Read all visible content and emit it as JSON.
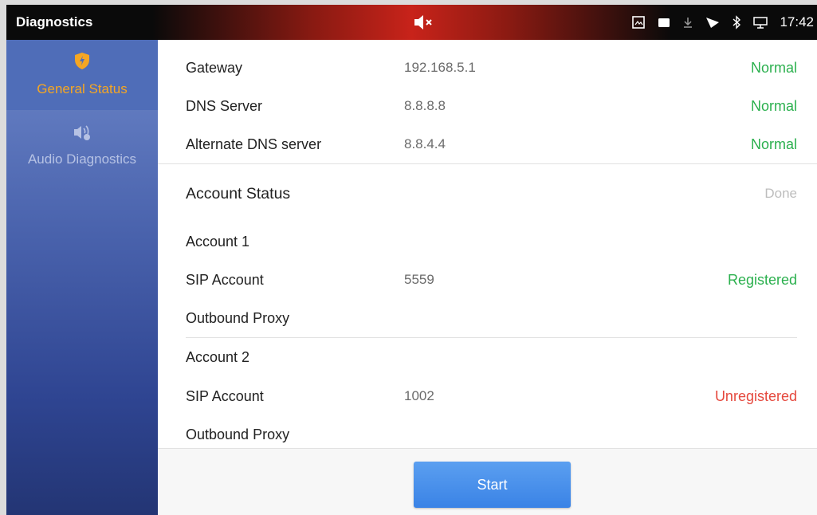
{
  "statusbar": {
    "title": "Diagnostics",
    "time": "17:42",
    "icons": [
      "volume-muted-icon",
      "screenshot-icon",
      "camera-icon",
      "download-icon",
      "wifi-signal-icon",
      "bluetooth-icon",
      "network-icon"
    ]
  },
  "sidebar": {
    "items": [
      {
        "label": "General Status",
        "icon": "shield-icon",
        "active": true
      },
      {
        "label": "Audio Diagnostics",
        "icon": "speaker-icon",
        "active": false
      }
    ]
  },
  "network": {
    "rows": [
      {
        "label": "Gateway",
        "value": "192.168.5.1",
        "status": "Normal"
      },
      {
        "label": "DNS Server",
        "value": "8.8.8.8",
        "status": "Normal"
      },
      {
        "label": "Alternate DNS server",
        "value": "8.8.4.4",
        "status": "Normal"
      }
    ]
  },
  "account_status": {
    "title": "Account Status",
    "status": "Done",
    "accounts": [
      {
        "name": "Account 1",
        "sip_label": "SIP Account",
        "sip_value": "5559",
        "sip_status": "Registered",
        "proxy_label": "Outbound Proxy"
      },
      {
        "name": "Account 2",
        "sip_label": "SIP Account",
        "sip_value": "1002",
        "sip_status": "Unregistered",
        "proxy_label": "Outbound Proxy"
      }
    ]
  },
  "actions": {
    "start_label": "Start"
  },
  "colors": {
    "normal": "#2bb04e",
    "error": "#e5483d",
    "accent": "#f5a623",
    "button": "#4a90e2"
  }
}
